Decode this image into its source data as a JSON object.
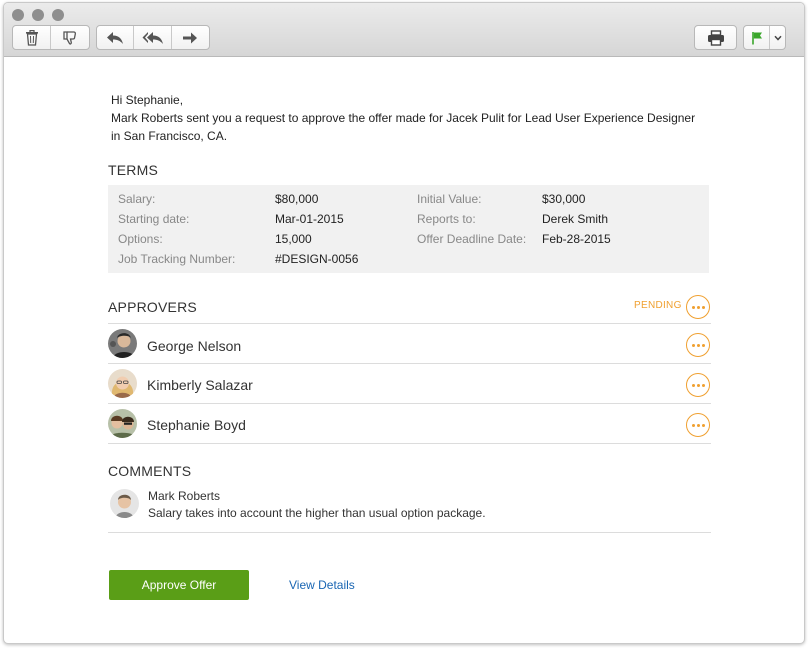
{
  "greeting": {
    "salutation": "Hi Stephanie,",
    "line1": "Mark Roberts sent you a request to approve the offer made for Jacek Pulit for Lead User Experience Designer",
    "line2": "in San Francisco, CA."
  },
  "terms": {
    "title": "TERMS",
    "left": [
      {
        "label": "Salary:",
        "value": "$80,000"
      },
      {
        "label": "Starting date:",
        "value": "Mar-01-2015"
      },
      {
        "label": "Options:",
        "value": "15,000"
      },
      {
        "label": "Job Tracking Number:",
        "value": "#DESIGN-0056"
      }
    ],
    "right": [
      {
        "label": "Initial Value:",
        "value": "$30,000"
      },
      {
        "label": "Reports to:",
        "value": "Derek Smith"
      },
      {
        "label": "Offer Deadline Date:",
        "value": "Feb-28-2015"
      }
    ]
  },
  "approvers": {
    "title": "APPROVERS",
    "status": "PENDING",
    "items": [
      {
        "name": "George Nelson"
      },
      {
        "name": "Kimberly Salazar"
      },
      {
        "name": "Stephanie Boyd"
      }
    ]
  },
  "comments": {
    "title": "COMMENTS",
    "items": [
      {
        "author": "Mark Roberts",
        "text": "Salary takes into account the higher than usual option package."
      }
    ]
  },
  "actions": {
    "approve_label": "Approve Offer",
    "details_label": "View Details"
  },
  "toolbar": {
    "icons": [
      "trash-icon",
      "thumbs-down-icon",
      "reply-icon",
      "reply-all-icon",
      "forward-icon",
      "print-icon",
      "flag-icon",
      "chevron-down-icon"
    ],
    "flag_color": "#3aa62b"
  },
  "colors": {
    "accent": "#f0a030",
    "approve": "#5a9e17",
    "link": "#1a66b3"
  }
}
